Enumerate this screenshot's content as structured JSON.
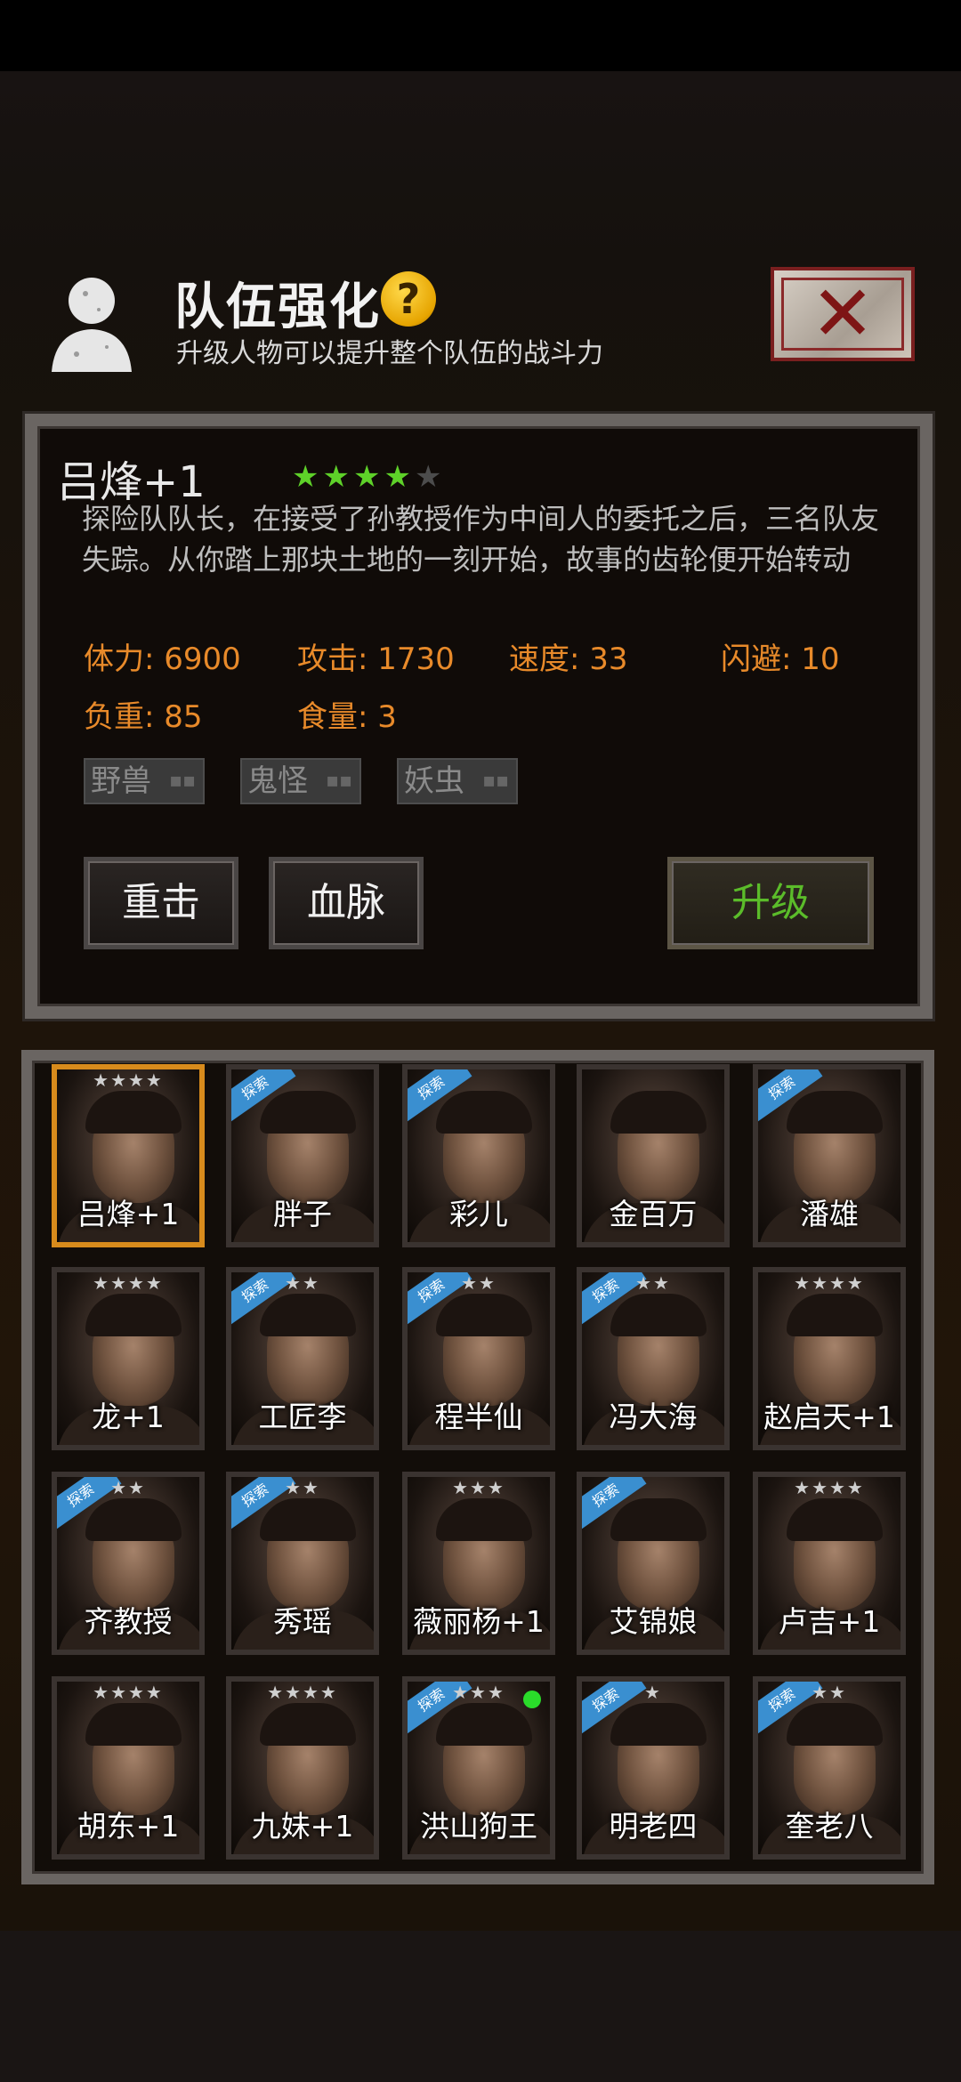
{
  "header": {
    "title": "队伍强化",
    "help_icon": "?",
    "subtitle": "升级人物可以提升整个队伍的战斗力",
    "close_glyph": "✕"
  },
  "selected": {
    "name": "吕烽+1",
    "stars": 4,
    "max_stars": 5,
    "description": "探险队队长，在接受了孙教授作为中间人的委托之后，三名队友失踪。从你踏上那块土地的一刻开始，故事的齿轮便开始转动",
    "stats": {
      "hp": "体力: 6900",
      "attack": "攻击: 1730",
      "speed": "速度: 33",
      "dodge": "闪避: 10",
      "load": "负重: 85",
      "food": "食量: 3"
    },
    "tags": [
      "野兽",
      "鬼怪",
      "妖虫"
    ],
    "tag_suffix": "▪▪",
    "buttons": {
      "skill1": "重击",
      "skill2": "血脉",
      "upgrade": "升级"
    }
  },
  "roster": [
    {
      "label": "吕烽+1",
      "stars": "★★★★",
      "badge": "",
      "online": false,
      "selected": true
    },
    {
      "label": "胖子",
      "stars": "",
      "badge": "探索",
      "online": false,
      "selected": false
    },
    {
      "label": "彩儿",
      "stars": "",
      "badge": "探索",
      "online": false,
      "selected": false
    },
    {
      "label": "金百万",
      "stars": "",
      "badge": "",
      "online": false,
      "selected": false
    },
    {
      "label": "潘雄",
      "stars": "",
      "badge": "探索",
      "online": false,
      "selected": false
    },
    {
      "label": "龙+1",
      "stars": "★★★★",
      "badge": "",
      "online": false,
      "selected": false
    },
    {
      "label": "工匠李",
      "stars": "★★",
      "badge": "探索",
      "online": false,
      "selected": false
    },
    {
      "label": "程半仙",
      "stars": "★★",
      "badge": "探索",
      "online": false,
      "selected": false
    },
    {
      "label": "冯大海",
      "stars": "★★",
      "badge": "探索",
      "online": false,
      "selected": false
    },
    {
      "label": "赵启天+1",
      "stars": "★★★★",
      "badge": "",
      "online": false,
      "selected": false
    },
    {
      "label": "齐教授",
      "stars": "★★",
      "badge": "探索",
      "online": false,
      "selected": false
    },
    {
      "label": "秀瑶",
      "stars": "★★",
      "badge": "探索",
      "online": false,
      "selected": false
    },
    {
      "label": "薇丽杨+1",
      "stars": "★★★",
      "badge": "",
      "online": false,
      "selected": false
    },
    {
      "label": "艾锦娘",
      "stars": "",
      "badge": "探索",
      "online": false,
      "selected": false
    },
    {
      "label": "卢吉+1",
      "stars": "★★★★",
      "badge": "",
      "online": false,
      "selected": false
    },
    {
      "label": "胡东+1",
      "stars": "★★★★",
      "badge": "",
      "online": false,
      "selected": false
    },
    {
      "label": "九妹+1",
      "stars": "★★★★",
      "badge": "",
      "online": false,
      "selected": false
    },
    {
      "label": "洪山狗王",
      "stars": "★★★",
      "badge": "探索",
      "online": true,
      "selected": false
    },
    {
      "label": "明老四",
      "stars": "★",
      "badge": "探索",
      "online": false,
      "selected": false
    },
    {
      "label": "奎老八",
      "stars": "★★",
      "badge": "探索",
      "online": false,
      "selected": false
    }
  ],
  "colors": {
    "stat": "#e88a2a",
    "star_on": "#5ed129",
    "upgrade": "#5bbc2a",
    "selected_border": "#d88b1c",
    "badge": "#3a8fd0"
  }
}
